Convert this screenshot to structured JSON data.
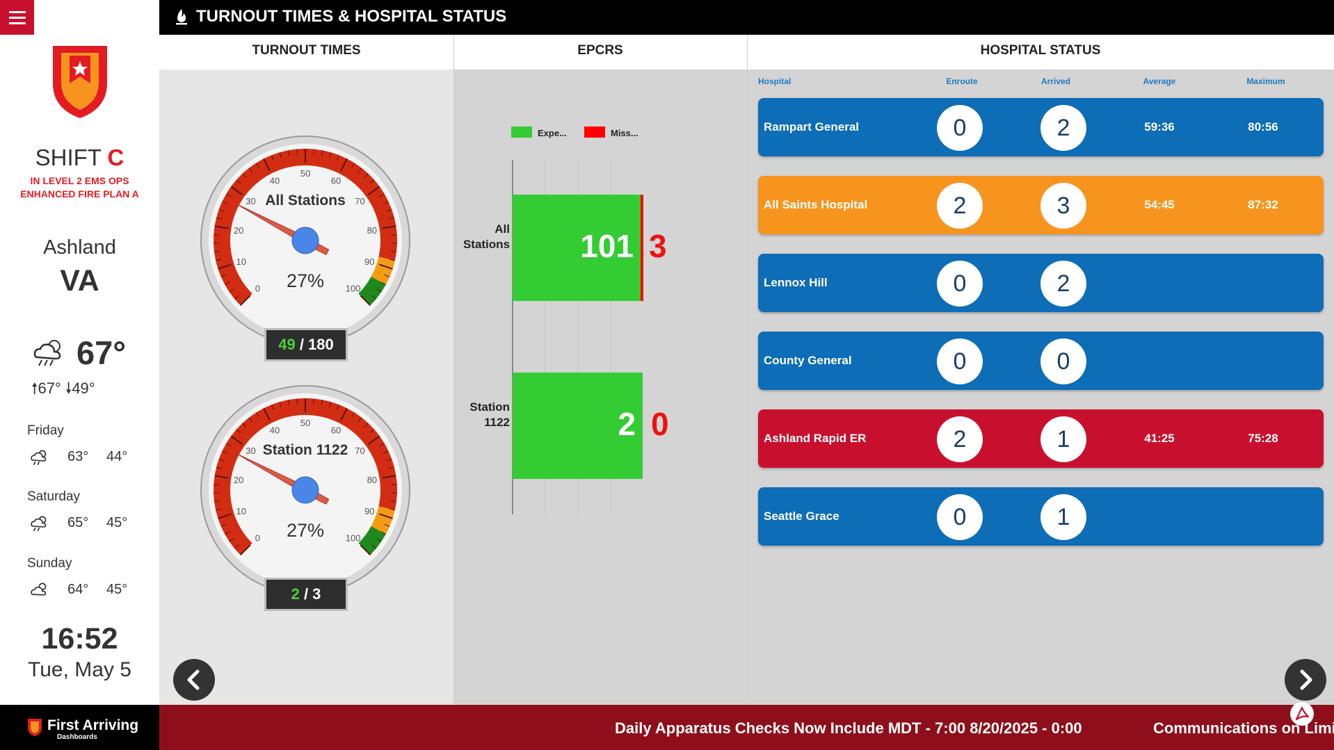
{
  "header": {
    "title": "TURNOUT TIMES & HOSPITAL STATUS"
  },
  "columns": {
    "turnout": "TURNOUT TIMES",
    "epcrs": "EPCRS",
    "hospital": "HOSPITAL STATUS"
  },
  "sidebar": {
    "shift_label": "SHIFT",
    "shift_value": "C",
    "level_line1": "IN LEVEL 2 EMS OPS",
    "level_line2": "ENHANCED FIRE PLAN A",
    "city": "Ashland",
    "state": "VA",
    "weather": {
      "current_temp": "67°",
      "high": "67°",
      "low": "49°",
      "forecast": [
        {
          "day": "Friday",
          "high": "63°",
          "low": "44°",
          "icon": "thunderstorm-icon"
        },
        {
          "day": "Saturday",
          "high": "65°",
          "low": "45°",
          "icon": "thunderstorm-icon"
        },
        {
          "day": "Sunday",
          "high": "64°",
          "low": "45°",
          "icon": "partly-cloudy-icon"
        }
      ]
    },
    "time": "16:52",
    "date": "Tue, May 5",
    "brand": {
      "name": "First Arriving",
      "sub": "Dashboards"
    }
  },
  "gauges": [
    {
      "label": "All Stations",
      "percent": 27,
      "percent_text": "27%",
      "count": "49",
      "total": "180"
    },
    {
      "label": "Station 1122",
      "percent": 27,
      "percent_text": "27%",
      "count": "2",
      "total": "3"
    }
  ],
  "gauge_ticks": [
    "0",
    "10",
    "20",
    "30",
    "40",
    "50",
    "60",
    "70",
    "80",
    "90",
    "100"
  ],
  "chart_data": {
    "type": "bar",
    "orientation": "horizontal",
    "stacked": true,
    "legend": [
      "Expe...",
      "Miss..."
    ],
    "categories": [
      [
        "All",
        "Stations"
      ],
      [
        "Station",
        "1122"
      ]
    ],
    "series": [
      {
        "name": "Expe...",
        "color": "#33cc33",
        "values": [
          101,
          2
        ]
      },
      {
        "name": "Miss...",
        "color": "#ff0000",
        "values": [
          3,
          0
        ]
      }
    ]
  },
  "hospital": {
    "headers": {
      "hospital": "Hospital",
      "enroute": "Enroute",
      "arrived": "Arrived",
      "average": "Average",
      "maximum": "Maximum"
    },
    "rows": [
      {
        "name": "Rampart General",
        "enroute": "0",
        "arrived": "2",
        "average": "59:36",
        "maximum": "80:56",
        "color": "#0d6db7"
      },
      {
        "name": "All Saints Hospital",
        "enroute": "2",
        "arrived": "3",
        "average": "54:45",
        "maximum": "87:32",
        "color": "#f7941d"
      },
      {
        "name": "Lennox Hill",
        "enroute": "0",
        "arrived": "2",
        "average": "",
        "maximum": "",
        "color": "#0d6db7"
      },
      {
        "name": "County General",
        "enroute": "0",
        "arrived": "0",
        "average": "",
        "maximum": "",
        "color": "#0d6db7"
      },
      {
        "name": "Ashland Rapid ER",
        "enroute": "2",
        "arrived": "1",
        "average": "41:25",
        "maximum": "75:28",
        "color": "#c8102e"
      },
      {
        "name": "Seattle Grace",
        "enroute": "0",
        "arrived": "1",
        "average": "",
        "maximum": "",
        "color": "#0d6db7"
      }
    ]
  },
  "ticker": [
    "Daily Apparatus Checks Now Include MDT - 7:00 8/20/2025 - 0:00",
    "Communications on Limit"
  ]
}
